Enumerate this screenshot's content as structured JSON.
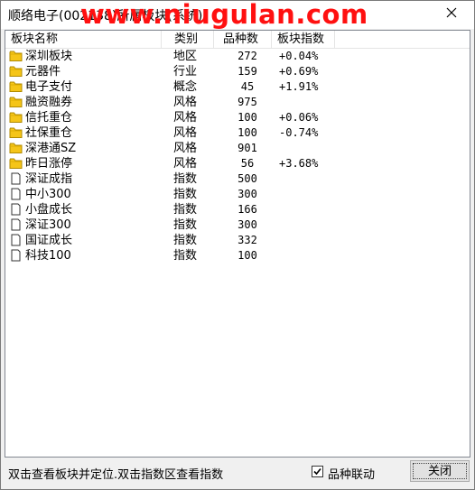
{
  "window": {
    "title": "顺络电子(002138)所属板块(系统)",
    "watermark": "www.niugulan.com",
    "close_icon": "close-x"
  },
  "colors": {
    "watermark": "#ff1010",
    "folder": "#e8b800"
  },
  "table": {
    "columns": [
      "板块名称",
      "类别",
      "品种数",
      "板块指数"
    ],
    "rows": [
      {
        "icon": "folder-icon",
        "name": "深圳板块",
        "type": "地区",
        "count": "272",
        "index": "+0.04%"
      },
      {
        "icon": "folder-icon",
        "name": "元器件",
        "type": "行业",
        "count": "159",
        "index": "+0.69%"
      },
      {
        "icon": "folder-icon",
        "name": "电子支付",
        "type": "概念",
        "count": "45",
        "index": "+1.91%"
      },
      {
        "icon": "folder-icon",
        "name": "融资融券",
        "type": "风格",
        "count": "975",
        "index": ""
      },
      {
        "icon": "folder-icon",
        "name": "信托重仓",
        "type": "风格",
        "count": "100",
        "index": "+0.06%"
      },
      {
        "icon": "folder-icon",
        "name": "社保重仓",
        "type": "风格",
        "count": "100",
        "index": "-0.74%"
      },
      {
        "icon": "folder-icon",
        "name": "深港通SZ",
        "type": "风格",
        "count": "901",
        "index": ""
      },
      {
        "icon": "folder-icon",
        "name": "昨日涨停",
        "type": "风格",
        "count": "56",
        "index": "+3.68%"
      },
      {
        "icon": "document-icon",
        "name": "深证成指",
        "type": "指数",
        "count": "500",
        "index": ""
      },
      {
        "icon": "document-icon",
        "name": "中小300",
        "type": "指数",
        "count": "300",
        "index": ""
      },
      {
        "icon": "document-icon",
        "name": "小盘成长",
        "type": "指数",
        "count": "166",
        "index": ""
      },
      {
        "icon": "document-icon",
        "name": "深证300",
        "type": "指数",
        "count": "300",
        "index": ""
      },
      {
        "icon": "document-icon",
        "name": "国证成长",
        "type": "指数",
        "count": "332",
        "index": ""
      },
      {
        "icon": "document-icon",
        "name": "科技100",
        "type": "指数",
        "count": "100",
        "index": ""
      }
    ]
  },
  "footer": {
    "hint": "双击查看板块并定位.双击指数区查看指数",
    "checkbox_label": "品种联动",
    "checkbox_checked": true,
    "close_button": "关闭"
  }
}
